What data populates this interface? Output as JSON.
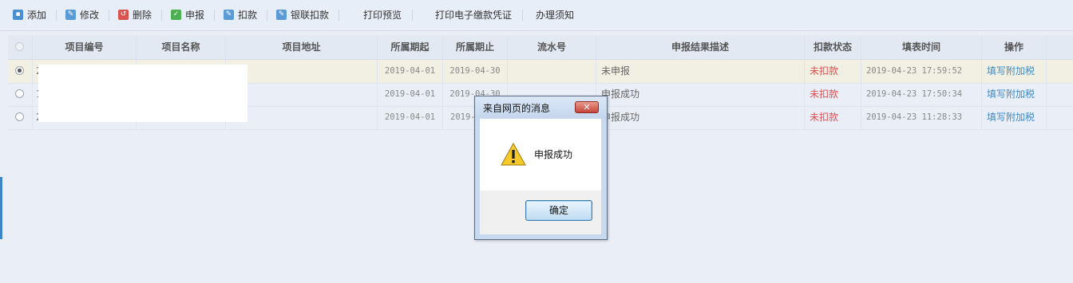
{
  "toolbar": {
    "buttons": [
      {
        "label": "添加",
        "icon": "save-icon",
        "color": "#4a90d0"
      },
      {
        "label": "修改",
        "icon": "edit-icon",
        "color": "#4a90d0"
      },
      {
        "label": "删除",
        "icon": "delete-icon",
        "color": "#d9534f"
      },
      {
        "label": "申报",
        "icon": "check-icon",
        "color": "#4caf50"
      },
      {
        "label": "扣款",
        "icon": "deduct-icon",
        "color": "#4a90d0"
      },
      {
        "label": "银联扣款",
        "icon": "unionpay-icon",
        "color": "#4a90d0"
      }
    ],
    "print_preview": "打印预览",
    "print_voucher": "打印电子缴款凭证",
    "guide": "办理须知"
  },
  "grid": {
    "columns": [
      "项目编号",
      "项目名称",
      "项目地址",
      "所属期起",
      "所属期止",
      "流水号",
      "申报结果描述",
      "扣款状态",
      "填表时间",
      "操作"
    ],
    "rows": [
      {
        "selected": true,
        "id": "2",
        "start": "2019-04-01",
        "end": "2019-04-30",
        "desc": "未申报",
        "status": "未扣款",
        "time": "2019-04-23 17:59:52",
        "action": "填写附加税"
      },
      {
        "selected": false,
        "id": "1",
        "start": "2019-04-01",
        "end": "2019-04-30",
        "desc": "申报成功",
        "status": "未扣款",
        "time": "2019-04-23 17:50:34",
        "action": "填写附加税"
      },
      {
        "selected": false,
        "id": "2",
        "start": "2019-04-01",
        "end": "2019-",
        "desc": "申报成功",
        "status": "未扣款",
        "time": "2019-04-23 11:28:33",
        "action": "填写附加税"
      }
    ]
  },
  "dialog": {
    "title": "来自网页的消息",
    "message": "申报成功",
    "ok_label": "确定",
    "close_glyph": "✕"
  }
}
